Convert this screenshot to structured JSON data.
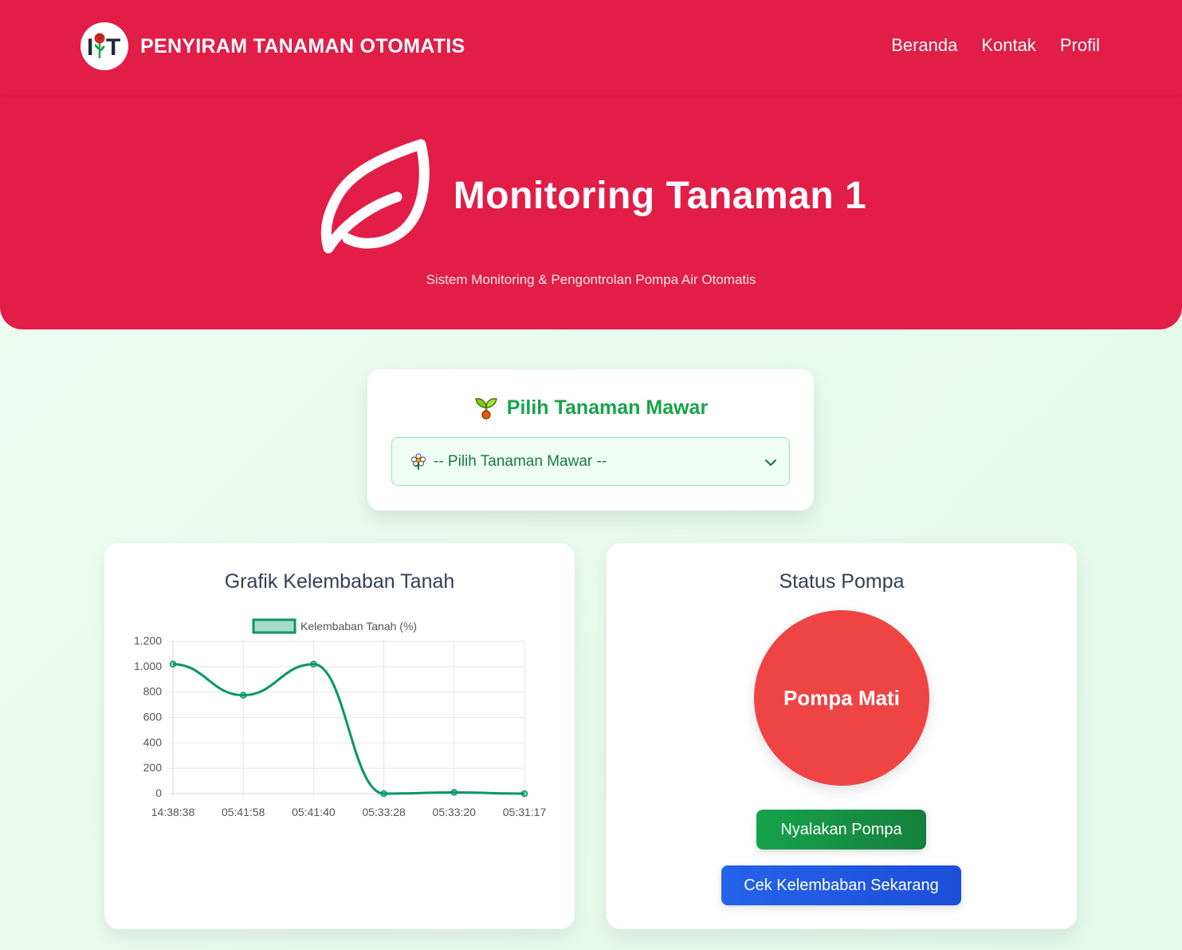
{
  "navbar": {
    "brand": "PENYIRAM TANAMAN OTOMATIS",
    "logo_icon": "rose-logo-icon",
    "links": [
      "Beranda",
      "Kontak",
      "Profil"
    ]
  },
  "hero": {
    "title": "Monitoring Tanaman 1",
    "subtitle": "Sistem Monitoring & Pengontrolan Pompa Air Otomatis",
    "icon": "leaf-icon"
  },
  "plant_select": {
    "title": "Pilih Tanaman Mawar",
    "selected": "-- Pilih Tanaman Mawar --",
    "title_icon": "seedling-icon",
    "option_icon": "flower-icon"
  },
  "chart_card": {
    "title": "Grafik Kelembaban Tanah"
  },
  "chart_data": {
    "type": "line",
    "title": "",
    "xlabel": "",
    "ylabel": "",
    "categories": [
      "14:38:38",
      "05:41:58",
      "05:41:40",
      "05:33:28",
      "05:33:20",
      "05:31:17"
    ],
    "series": [
      {
        "name": "Kelembaban Tanah (%)",
        "values": [
          1020,
          775,
          1020,
          0,
          10,
          0
        ]
      }
    ],
    "ylim": [
      0,
      1200
    ],
    "yticks": [
      "0",
      "200",
      "400",
      "600",
      "800",
      "1.000",
      "1.200"
    ],
    "legend": "top",
    "grid": true,
    "color": "#059669"
  },
  "status_card": {
    "title": "Status Pompa",
    "pump_status": "Pompa Mati",
    "btn_on": "Nyalakan Pompa",
    "btn_check": "Cek Kelembaban Sekarang"
  },
  "colors": {
    "brand_red": "#e11d48",
    "pump_off": "#ef4444",
    "green": "#16a34a",
    "blue": "#2563eb"
  }
}
